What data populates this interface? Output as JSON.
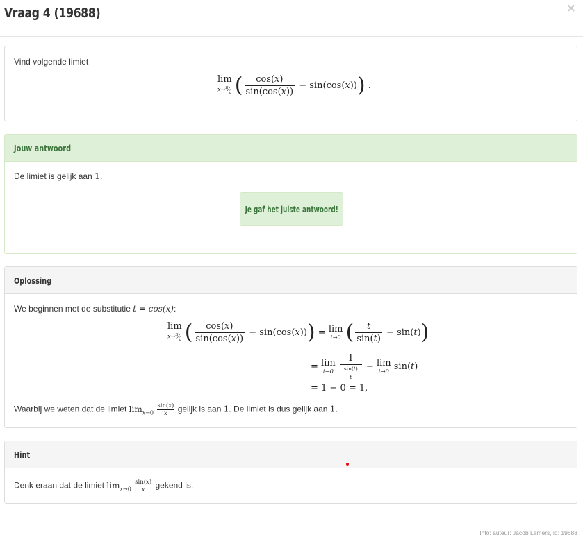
{
  "modal": {
    "title": "Vraag 4 (19688)",
    "close_symbol": "×"
  },
  "question": {
    "intro": "Vind volgende limiet"
  },
  "answer": {
    "heading": "Jouw antwoord",
    "text": "De limiet is gelijk aan",
    "value": "1",
    "feedback": "Je gaf het juiste antwoord!"
  },
  "solution": {
    "heading": "Oplossing",
    "intro": "We beginnen met de substitutie",
    "substitution": "t = cos(x)",
    "conclusion_before": "Waarbij we weten dat de limiet",
    "conclusion_middle": "gelijk is aan",
    "conclusion_value": "1",
    "conclusion_after": ". De limiet is dus gelijk aan",
    "final_value": "1"
  },
  "hint": {
    "heading": "Hint",
    "text_before": "Denk eraan dat de limiet",
    "text_after": "gekend is."
  },
  "footer": {
    "info": "Info: auteur: Jacob Lamers, id: 19688"
  },
  "colors": {
    "success_bg": "#dff0d8",
    "success_text": "#3c763d",
    "panel_heading_bg": "#f5f5f5",
    "border": "#dddddd"
  }
}
